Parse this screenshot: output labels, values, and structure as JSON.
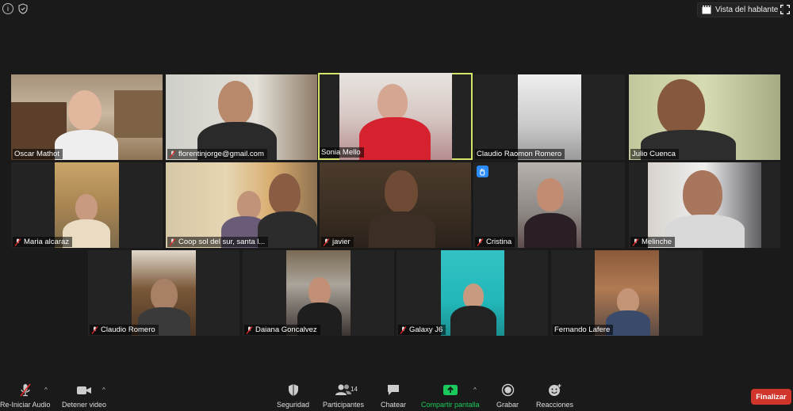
{
  "top": {
    "speaker_view_label": "Vista del hablante"
  },
  "participants": [
    {
      "name": "Oscar Mathot"
    },
    {
      "name": "florentinjorge@gmail.com"
    },
    {
      "name": "Sonia Mello"
    },
    {
      "name": "Claudio Raomon Romero"
    },
    {
      "name": "Julio Cuenca"
    },
    {
      "name": "Maria alcaraz"
    },
    {
      "name": "Coop sol del sur, santa l..."
    },
    {
      "name": "javier"
    },
    {
      "name": "Cristina"
    },
    {
      "name": "Melinche"
    },
    {
      "name": "Claudio Romero"
    },
    {
      "name": "Daiana Goncalvez"
    },
    {
      "name": "Galaxy J6"
    },
    {
      "name": "Fernando Lafere"
    }
  ],
  "toolbar": {
    "audio": "Re-Iniciar Audio",
    "video": "Detener video",
    "security": "Seguridad",
    "participants": "Participantes",
    "participants_count": "14",
    "chat": "Chatear",
    "share": "Compartir pantalla",
    "record": "Grabar",
    "reactions": "Reacciones",
    "end": "Finalizar"
  },
  "colors": {
    "background": "#1a1a1a",
    "tile": "#232323",
    "active_speaker": "#d6e46b",
    "share_green": "#19c95b",
    "end_red": "#d0352c",
    "raise_hand_blue": "#2d8cff"
  }
}
